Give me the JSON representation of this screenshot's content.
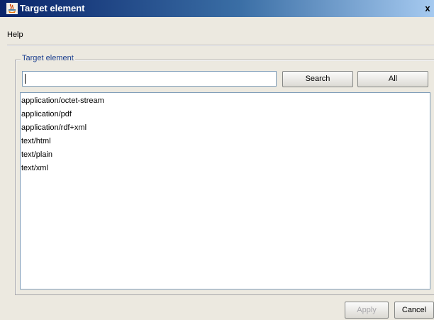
{
  "window": {
    "title": "Target element",
    "close_label": "x",
    "icon": "java-coffee-icon"
  },
  "menu": {
    "items": [
      "Help"
    ]
  },
  "group": {
    "legend": "Target element"
  },
  "search": {
    "value": "",
    "search_label": "Search",
    "all_label": "All"
  },
  "list": {
    "items": [
      "application/octet-stream",
      "application/pdf",
      "application/rdf+xml",
      "text/html",
      "text/plain",
      "text/xml"
    ]
  },
  "footer": {
    "apply_label": "Apply",
    "apply_enabled": false,
    "cancel_label": "Cancel"
  }
}
